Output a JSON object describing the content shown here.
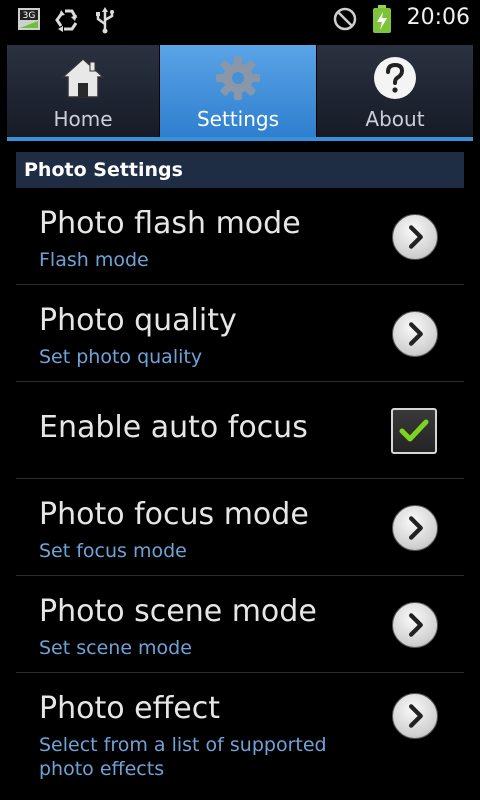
{
  "status_bar": {
    "time": "20:06",
    "network_label": "3G",
    "icons": [
      "sim-3g-icon",
      "recycle-icon",
      "usb-icon",
      "no-signal-icon",
      "battery-charging-icon"
    ]
  },
  "tabs": [
    {
      "label": "Home",
      "icon": "home-icon",
      "active": false
    },
    {
      "label": "Settings",
      "icon": "gear-icon",
      "active": true
    },
    {
      "label": "About",
      "icon": "help-icon",
      "active": false
    }
  ],
  "section": {
    "title": "Photo Settings"
  },
  "settings": [
    {
      "title": "Photo flash mode",
      "subtitle": "Flash mode",
      "control": "chevron-right-icon"
    },
    {
      "title": "Photo quality",
      "subtitle": "Set photo quality",
      "control": "chevron-right-icon"
    },
    {
      "title": "Enable auto focus",
      "subtitle": "",
      "control": "checkbox",
      "checked": true
    },
    {
      "title": "Photo focus mode",
      "subtitle": "Set focus mode",
      "control": "chevron-right-icon"
    },
    {
      "title": "Photo scene mode",
      "subtitle": "Set scene mode",
      "control": "chevron-right-icon"
    },
    {
      "title": "Photo effect",
      "subtitle": "Select from a list of supported photo effects",
      "control": "chevron-right-icon"
    }
  ],
  "colors": {
    "accent": "#3a90d8",
    "subtitle": "#6fa3d8",
    "section_header_bg": "#1e2c44",
    "check_green": "#7ed321"
  }
}
